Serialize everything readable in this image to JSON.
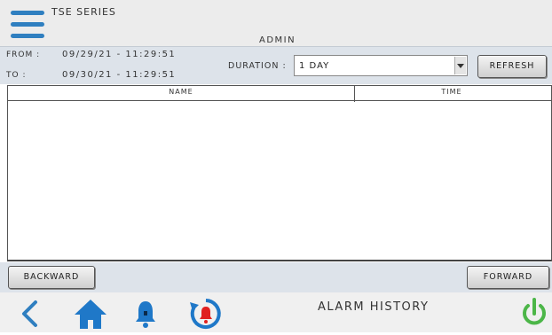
{
  "header": {
    "brand": "TSE SERIES",
    "user": "ADMIN"
  },
  "filter": {
    "from_label": "FROM :",
    "from_value": "09/29/21 - 11:29:51",
    "to_label": "TO :",
    "to_value": "09/30/21 - 11:29:51",
    "duration_label": "DURATION :",
    "duration_value": "1 DAY",
    "refresh_label": "REFRESH"
  },
  "table": {
    "columns": [
      "NAME",
      "TIME"
    ],
    "rows": []
  },
  "pager": {
    "backward_label": "BACKWARD",
    "forward_label": "FORWARD"
  },
  "navbar": {
    "screen_title": "ALARM HISTORY",
    "icons": [
      "back-icon",
      "home-icon",
      "alarm-bell-icon",
      "alarm-history-icon",
      "power-icon"
    ]
  },
  "colors": {
    "accent_blue": "#2f7fc0",
    "alarm_red": "#e02020",
    "power_green": "#4cb648",
    "panel_bg": "#dde3ea"
  }
}
